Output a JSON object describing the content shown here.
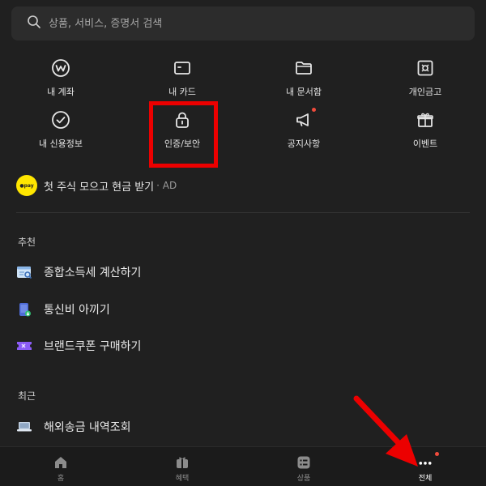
{
  "search": {
    "placeholder": "상품, 서비스, 증명서 검색"
  },
  "grid": [
    {
      "label": "내 계좌",
      "icon": "account-icon"
    },
    {
      "label": "내 카드",
      "icon": "card-icon"
    },
    {
      "label": "내 문서함",
      "icon": "folder-icon"
    },
    {
      "label": "개인금고",
      "icon": "safe-icon"
    },
    {
      "label": "내 신용정보",
      "icon": "check-circle-icon"
    },
    {
      "label": "인증/보안",
      "icon": "lock-icon"
    },
    {
      "label": "공지사항",
      "icon": "megaphone-icon"
    },
    {
      "label": "이벤트",
      "icon": "gift-icon"
    }
  ],
  "ad": {
    "badge": "●pay",
    "text": "첫 주식 모으고 현금 받기",
    "suffix": "· AD"
  },
  "recommended": {
    "title": "추천",
    "items": [
      {
        "label": "종합소득세 계산하기",
        "icon": "tax-calculator-icon"
      },
      {
        "label": "통신비 아끼기",
        "icon": "phone-bill-icon"
      },
      {
        "label": "브랜드쿠폰 구매하기",
        "icon": "coupon-icon"
      }
    ]
  },
  "recent": {
    "title": "최근",
    "items": [
      {
        "label": "해외송금 내역조회",
        "icon": "laptop-icon"
      }
    ]
  },
  "tabbar": {
    "items": [
      {
        "label": "홈",
        "icon": "home-icon"
      },
      {
        "label": "혜택",
        "icon": "benefit-icon"
      },
      {
        "label": "상품",
        "icon": "products-icon"
      },
      {
        "label": "전체",
        "icon": "more-dots-icon"
      }
    ]
  },
  "colors": {
    "background": "#202020",
    "highlight": "#ec0000",
    "notification_dot": "#f04b3c"
  }
}
